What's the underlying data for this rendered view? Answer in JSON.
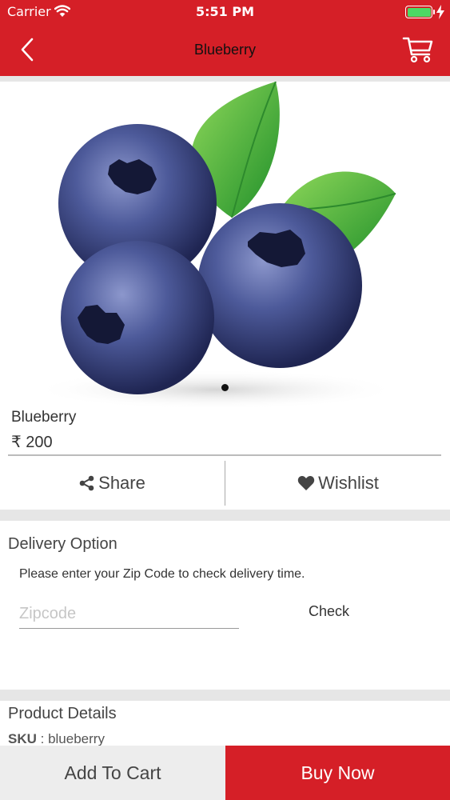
{
  "status_bar": {
    "carrier": "Carrier",
    "time": "5:51 PM"
  },
  "nav": {
    "title": "Blueberry"
  },
  "product": {
    "name": "Blueberry",
    "price": "₹ 200",
    "image_page_indicator": {
      "current": 1,
      "total": 1
    }
  },
  "actions": {
    "share_label": "Share",
    "wishlist_label": "Wishlist"
  },
  "delivery": {
    "title": "Delivery Option",
    "hint": "Please enter your Zip Code to check  delivery time.",
    "zip_placeholder": "Zipcode",
    "zip_value": "",
    "check_label": "Check"
  },
  "details": {
    "title": "Product Details",
    "sku_label": "SKU",
    "sku_separator": " : ",
    "sku_value": "blueberry"
  },
  "bottom_bar": {
    "add_to_cart_label": "Add To Cart",
    "buy_now_label": "Buy Now"
  },
  "colors": {
    "brand_red": "#d51f27",
    "background_gray": "#e6e6e6",
    "battery_green": "#4cd964"
  },
  "icons": [
    "wifi-icon",
    "battery-icon",
    "charging-bolt-icon",
    "back-chevron-icon",
    "cart-icon",
    "share-icon",
    "heart-icon"
  ]
}
